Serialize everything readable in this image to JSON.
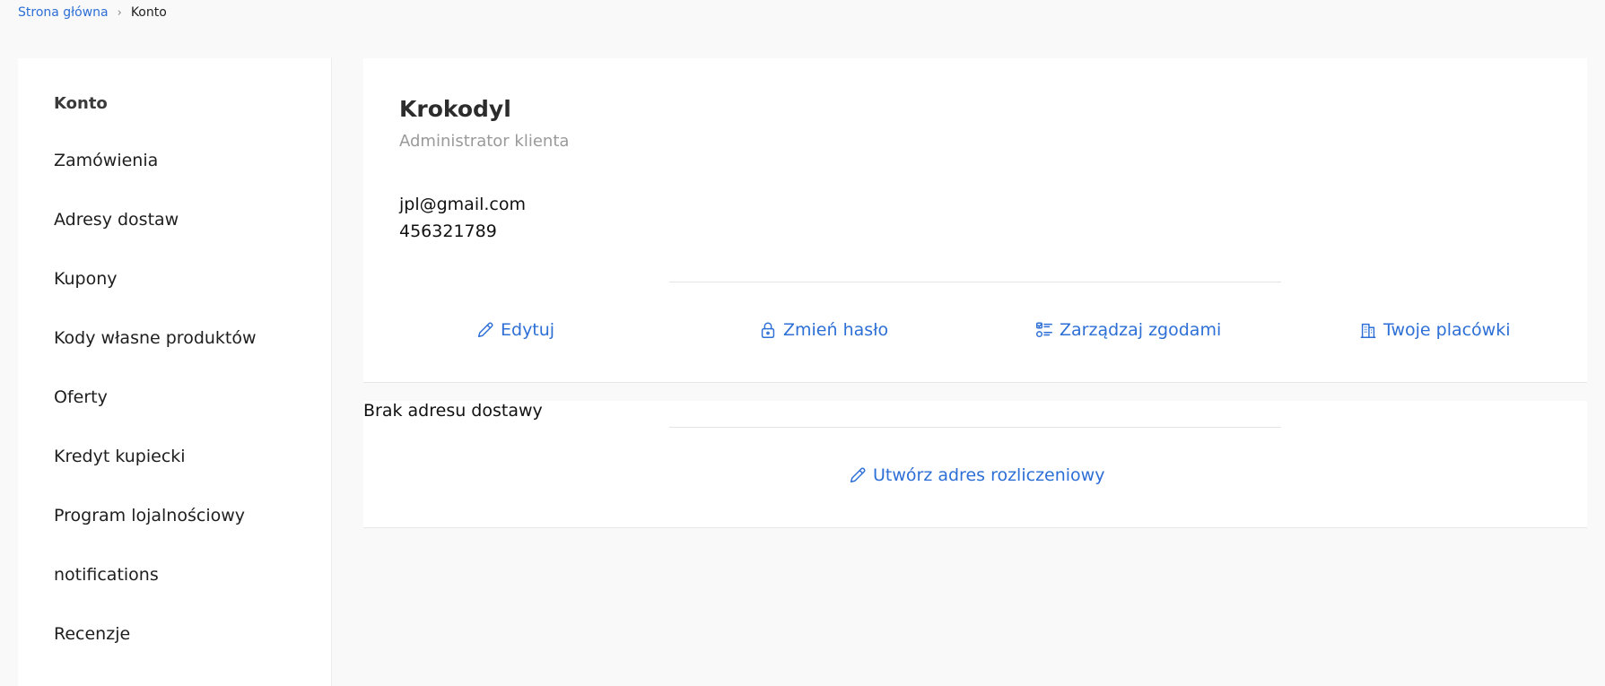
{
  "breadcrumb": {
    "home": "Strona główna",
    "separator": "›",
    "current": "Konto"
  },
  "sidebar": {
    "items": [
      {
        "label": "Konto",
        "active": true
      },
      {
        "label": "Zamówienia"
      },
      {
        "label": "Adresy dostaw"
      },
      {
        "label": "Kupony"
      },
      {
        "label": "Kody własne produktów"
      },
      {
        "label": "Oferty"
      },
      {
        "label": "Kredyt kupiecki"
      },
      {
        "label": "Program lojalnościowy"
      },
      {
        "label": "notifications"
      },
      {
        "label": "Recenzje"
      }
    ]
  },
  "account": {
    "name": "Krokodyl",
    "role": "Administrator klienta",
    "email": "jpl@gmail.com",
    "phone": "456321789",
    "actions": {
      "edit": {
        "label": "Edytuj",
        "icon": "pencil-icon"
      },
      "change_password": {
        "label": "Zmień hasło",
        "icon": "lock-icon"
      },
      "manage_consents": {
        "label": "Zarządzaj zgodami",
        "icon": "checklist-icon"
      },
      "your_places": {
        "label": "Twoje placówki",
        "icon": "building-icon"
      }
    }
  },
  "address": {
    "empty_text": "Brak adresu dostawy",
    "create_action": {
      "label": "Utwórz adres rozliczeniowy",
      "icon": "pencil-icon"
    }
  },
  "colors": {
    "accent": "#2d6fd6",
    "page_bg": "#f9f9f9",
    "card_bg": "#ffffff",
    "muted_text": "#9a9a9a"
  }
}
